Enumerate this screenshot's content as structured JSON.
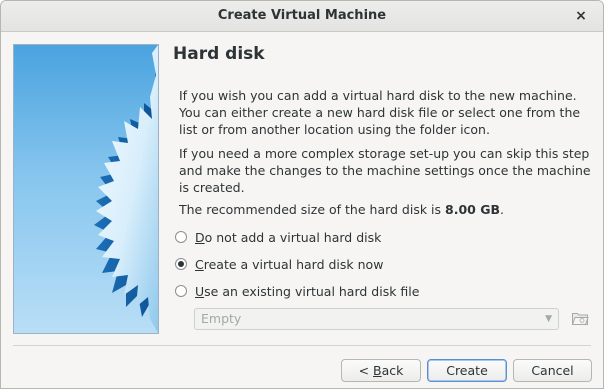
{
  "window": {
    "title": "Create Virtual Machine",
    "close_glyph": "×"
  },
  "page": {
    "heading": "Hard disk",
    "paragraph1": "If you wish you can add a virtual hard disk to the new machine. You can either create a new hard disk file or select one from the list or from another location using the folder icon.",
    "paragraph2": "If you need a more complex storage set-up you can skip this step and make the changes to the machine settings once the machine is created.",
    "recommended_prefix": "The recommended size of the hard disk is ",
    "recommended_size": "8.00 GB",
    "recommended_suffix": "."
  },
  "options": [
    {
      "mnemonic": "D",
      "rest": "o not add a virtual hard disk",
      "checked": false
    },
    {
      "mnemonic": "C",
      "rest": "reate a virtual hard disk now",
      "checked": true
    },
    {
      "mnemonic": "U",
      "rest": "se an existing virtual hard disk file",
      "checked": false
    }
  ],
  "existing_disk_combo": {
    "value": "Empty",
    "enabled": false
  },
  "icons": {
    "folder": "folder-open-icon",
    "close": "close-icon",
    "dropdown": "chevron-down-icon"
  },
  "buttons": {
    "back_prefix": "< ",
    "back_mnemonic": "B",
    "back_rest": "ack",
    "create": "Create",
    "cancel": "Cancel"
  }
}
